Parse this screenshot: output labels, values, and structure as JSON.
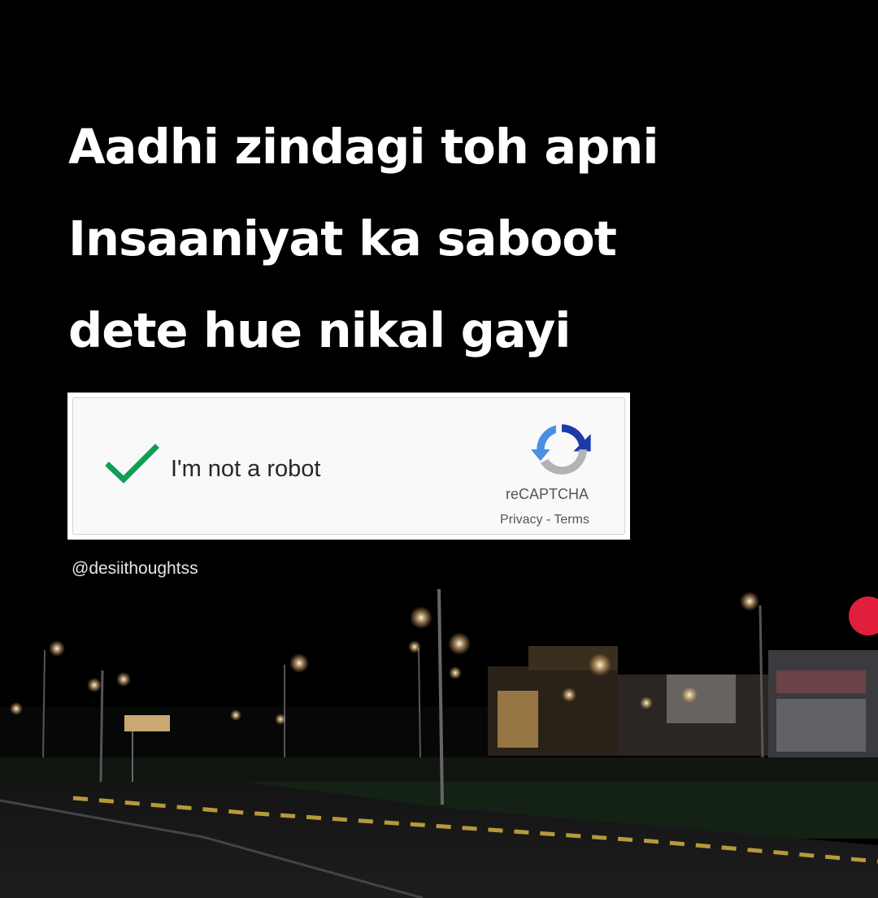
{
  "headline": {
    "lines": [
      "Aadhi zindagi toh apni",
      "Insaaniyat ka saboot",
      "dete hue nikal gayi"
    ]
  },
  "captcha": {
    "label": "I'm not a robot",
    "checked": true,
    "brand": "reCAPTCHA",
    "privacy_link": "Privacy",
    "separator": " - ",
    "terms_link": "Terms",
    "check_icon": "checkmark-icon",
    "logo_icon": "recaptcha-logo-icon"
  },
  "watermark": "@desiithoughtss",
  "colors": {
    "background": "#000000",
    "headline_text": "#ffffff",
    "check_green": "#0f9d58",
    "recaptcha_blue": "#1c3aa9",
    "recaptcha_light_blue": "#4a90e2",
    "recaptcha_gray": "#b3b3b3"
  }
}
